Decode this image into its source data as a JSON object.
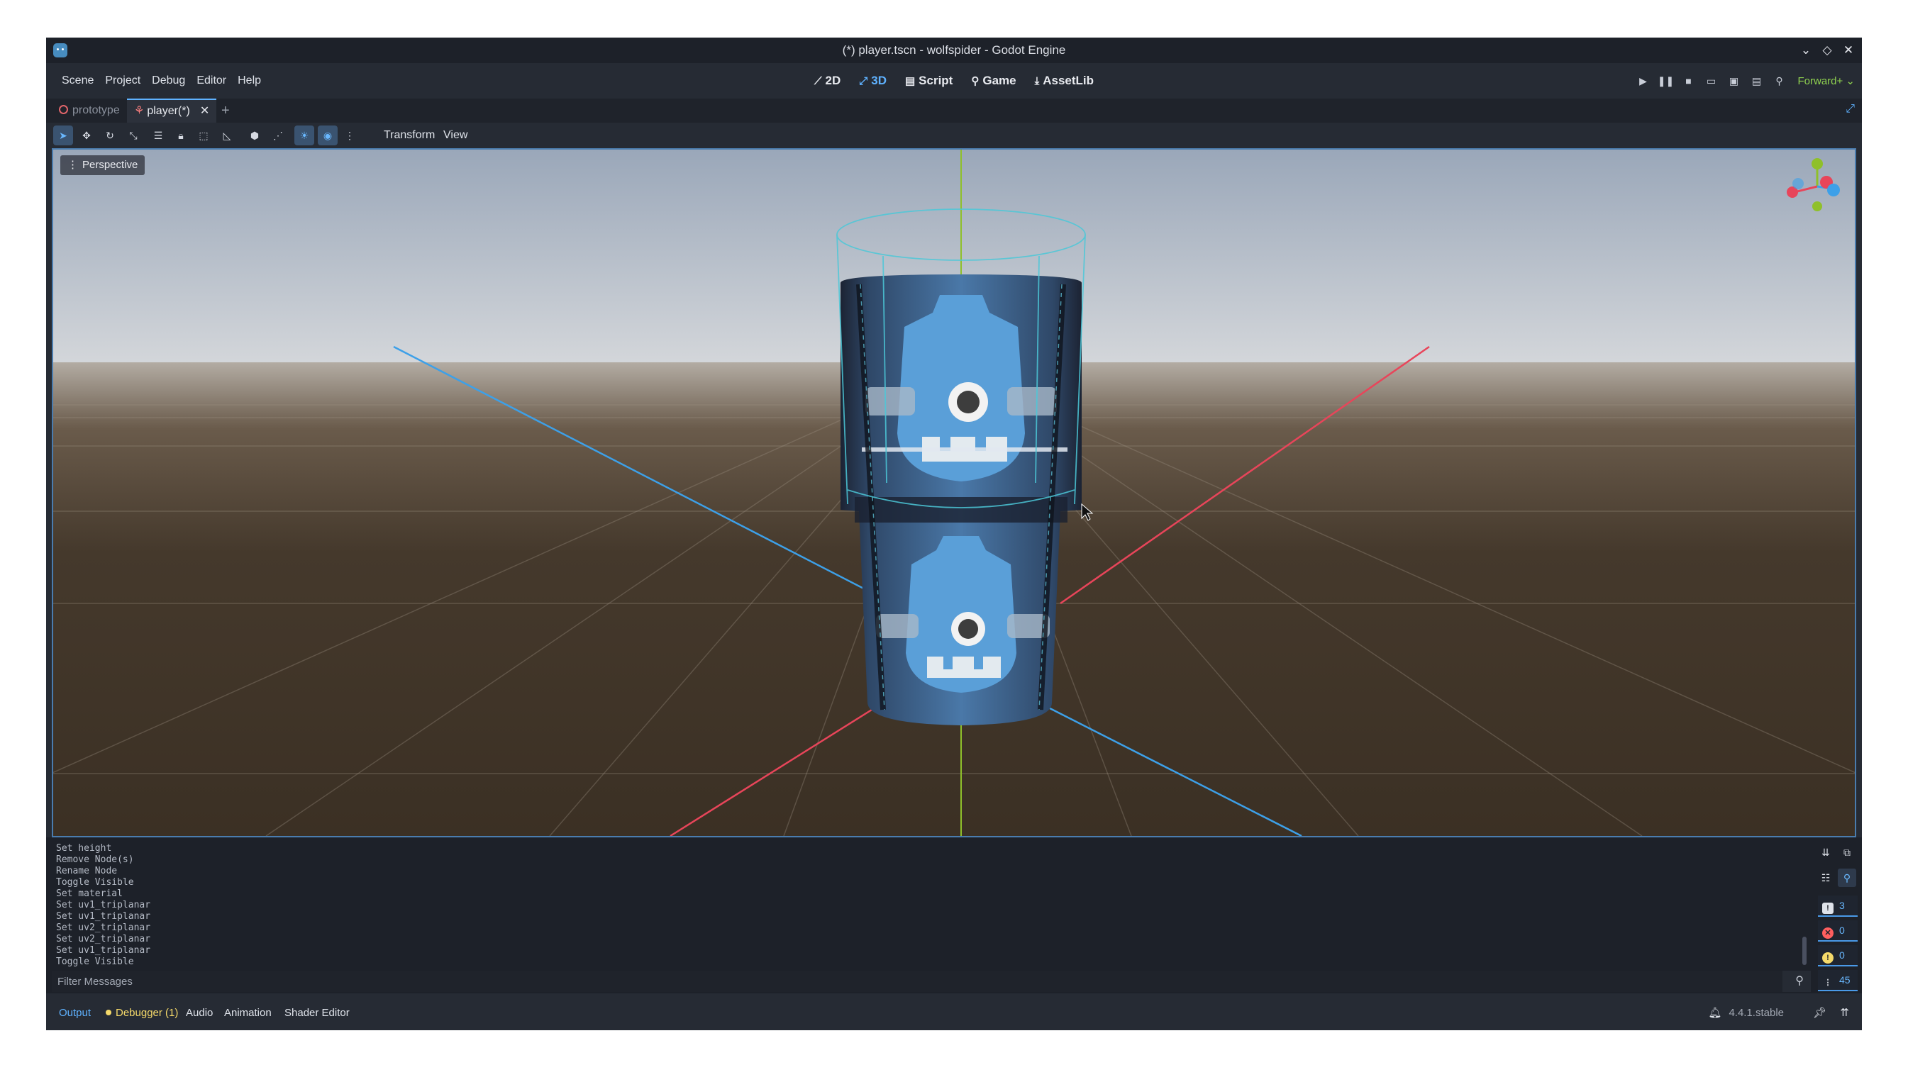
{
  "window": {
    "title": "(*) player.tscn - wolfspider - Godot Engine",
    "controls": {
      "minimize": "⌄",
      "maximize": "◇",
      "close": "✕"
    }
  },
  "menu": [
    "Scene",
    "Project",
    "Debug",
    "Editor",
    "Help"
  ],
  "workspaces": [
    {
      "label": "2D",
      "icon": "⟋"
    },
    {
      "label": "3D",
      "icon": "⤢",
      "active": true
    },
    {
      "label": "Script",
      "icon": "▤"
    },
    {
      "label": "Game",
      "icon": "⚲"
    },
    {
      "label": "AssetLib",
      "icon": "⤓"
    }
  ],
  "playbar": {
    "icons": [
      "play-icon",
      "pause-icon",
      "stop-icon",
      "remote-debug-icon",
      "movie-maker-icon",
      "run-scene-icon",
      "search-icon"
    ],
    "renderer": "Forward+ ⌄"
  },
  "scene_tabs": [
    {
      "label": "prototype"
    },
    {
      "label": "player(*)",
      "active": true,
      "close": "✕"
    }
  ],
  "scene_tab_add": "+",
  "toolbar": {
    "transform_menu": "Transform",
    "view_menu": "View"
  },
  "viewport": {
    "perspective_label": "Perspective",
    "perspective_prefix": "⋮",
    "gizmo_axes": [
      "Y",
      "X",
      "Z"
    ]
  },
  "output": {
    "lines": [
      "Set height",
      "Remove Node(s)",
      "Rename Node",
      "Toggle Visible",
      "Set material",
      "Set uv1_triplanar",
      "Set uv1_triplanar",
      "Set uv2_triplanar",
      "Set uv2_triplanar",
      "Set uv1_triplanar",
      "Toggle Visible"
    ],
    "filter_placeholder": "Filter Messages",
    "counts": {
      "messages": "3",
      "errors": "0",
      "warnings": "0",
      "editor": "45"
    }
  },
  "bottom_tabs": {
    "output": "Output",
    "debugger": "Debugger (1)",
    "audio": "Audio",
    "animation": "Animation",
    "shader_editor": "Shader Editor"
  },
  "version": "4.4.1.stable",
  "colors": {
    "accent": "#5fb2ff",
    "x_axis": "#e8455a",
    "z_axis": "#3da0e8",
    "y_axis": "#8fc02a",
    "renderer": "#8fd14f",
    "debugger_warning": "#f5d96a"
  }
}
